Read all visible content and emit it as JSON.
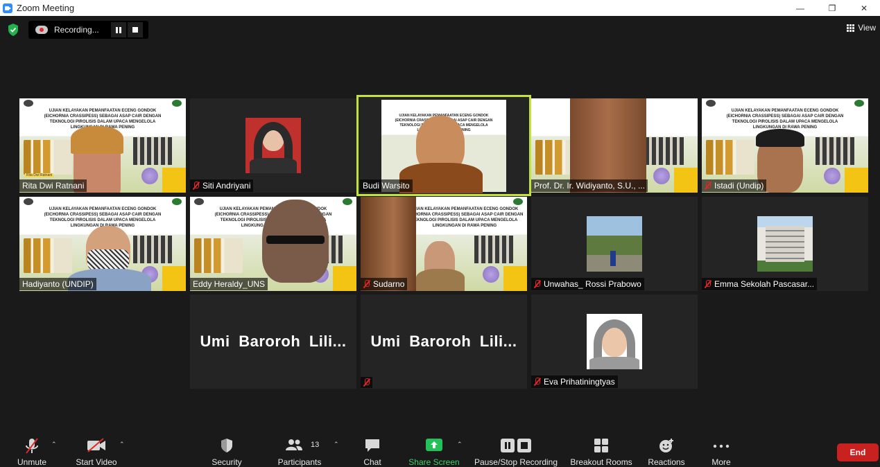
{
  "window": {
    "title": "Zoom Meeting",
    "minimize": "—",
    "restore": "❐",
    "close": "✕"
  },
  "topbar": {
    "recording_label": "Recording...",
    "view_label": "View"
  },
  "banner": {
    "title_lines": "UJIAN KELAYAKAN PEMANFAATAN ECENG GONDOK (EICHORNIA CRASSIPESS) SEBAGAI ASAP CAIR DENGAN TEKNOLOGI PIROLISIS DALAM UPACA MENGELOLA LINGKUNGAN DI RAWA PENING",
    "presenter": "Rita Dwi Ratnani"
  },
  "participants": [
    {
      "name": "Rita Dwi Ratnani",
      "muted": false
    },
    {
      "name": "Siti Andriyani",
      "muted": true
    },
    {
      "name": "Budi Warsito",
      "muted": false,
      "active": true
    },
    {
      "name": "Prof. Dr. Ir. Widiyanto, S.U., ...",
      "muted": false
    },
    {
      "name": "Istadi (Undip)",
      "muted": true
    },
    {
      "name": "Hadiyanto (UNDIP)",
      "muted": false
    },
    {
      "name": "Eddy Heraldy_UNS",
      "muted": false
    },
    {
      "name": "Sudarno",
      "muted": true
    },
    {
      "name": "Unwahas_ Rossi Prabowo",
      "muted": true
    },
    {
      "name": "Emma Sekolah Pascasar...",
      "muted": true
    },
    {
      "name": "Umi Baroroh Lili...",
      "muted": false
    },
    {
      "name": "Umi Baroroh Lili...",
      "muted": true
    },
    {
      "name": "Eva Prihatiningtyas",
      "muted": true
    }
  ],
  "toolbar": {
    "unmute": "Unmute",
    "start_video": "Start Video",
    "security": "Security",
    "participants": "Participants",
    "participants_count": "13",
    "chat": "Chat",
    "share_screen": "Share Screen",
    "pause_stop_recording": "Pause/Stop Recording",
    "breakout_rooms": "Breakout Rooms",
    "reactions": "Reactions",
    "more": "More",
    "end": "End"
  },
  "colors": {
    "active_speaker": "#c4e33a",
    "end_button": "#c92020",
    "share_green": "#3fd068",
    "mute_red": "#e02828"
  }
}
